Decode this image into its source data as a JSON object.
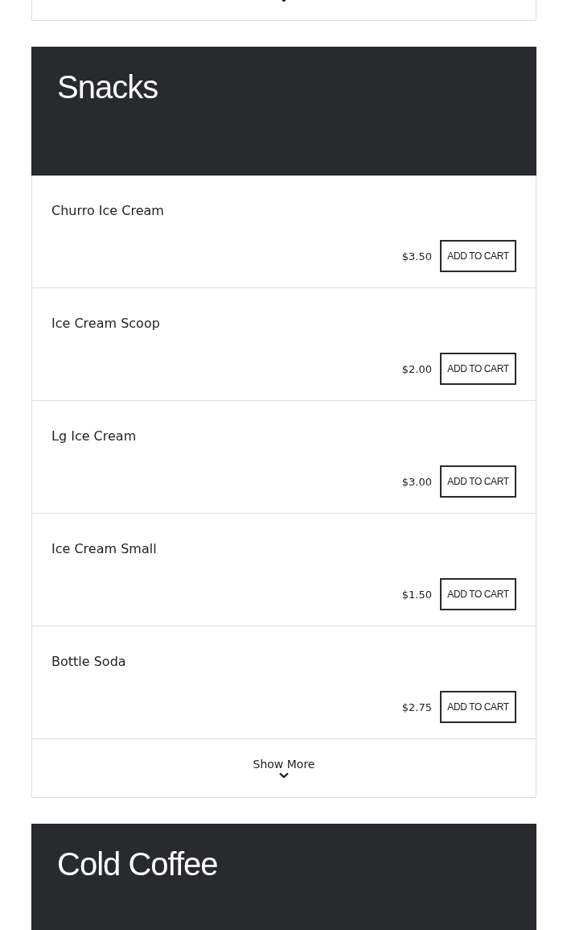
{
  "sections": [
    {
      "title": "Snacks",
      "items": [
        {
          "name": "Churro Ice Cream",
          "price": "$3.50",
          "button": "ADD TO CART"
        },
        {
          "name": "Ice Cream Scoop",
          "price": "$2.00",
          "button": "ADD TO CART"
        },
        {
          "name": "Lg Ice Cream",
          "price": "$3.00",
          "button": "ADD TO CART"
        },
        {
          "name": "Ice Cream Small",
          "price": "$1.50",
          "button": "ADD TO CART"
        },
        {
          "name": "Bottle Soda",
          "price": "$2.75",
          "button": "ADD TO CART"
        }
      ],
      "show_more": "Show More"
    },
    {
      "title": "Cold Coffee"
    }
  ]
}
